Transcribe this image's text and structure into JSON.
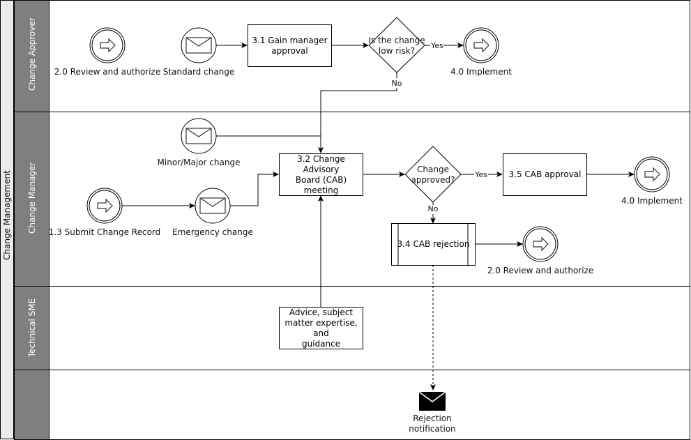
{
  "pool": {
    "title": "Change Management"
  },
  "lanes": [
    {
      "id": "approver",
      "title": "Change Approver"
    },
    {
      "id": "manager",
      "title": "Change Manager"
    },
    {
      "id": "sme",
      "title": "Technical SME"
    },
    {
      "id": "blank",
      "title": ""
    }
  ],
  "events": {
    "review_top": "2.0 Review and authorize",
    "standard_change": "Standard change",
    "implement_top": "4.0 Implement",
    "minor_major": "Minor/Major change",
    "submit_record": "1.3 Submit Change Record",
    "emergency_change": "Emergency change",
    "implement_mid": "4.0 Implement",
    "review_mid": "2.0 Review and authorize",
    "rejection_line1": "Rejection",
    "rejection_line2": "notification"
  },
  "tasks": {
    "gain_approval_l1": "3.1 Gain manager",
    "gain_approval_l2": "approval",
    "cab_meeting_l1": "3.2 Change Advisory",
    "cab_meeting_l2": "Board (CAB) meeting",
    "cab_approval": "3.5 CAB approval",
    "cab_rejection": "3.4 CAB rejection",
    "advice_l1": "Advice, subject",
    "advice_l2": "matter expertise, and",
    "advice_l3": "guidance"
  },
  "gateways": {
    "low_risk_l1": "Is the change",
    "low_risk_l2": "low risk?",
    "approved_l1": "Change",
    "approved_l2": "approved?"
  },
  "flow_labels": {
    "yes": "Yes",
    "no": "No"
  }
}
